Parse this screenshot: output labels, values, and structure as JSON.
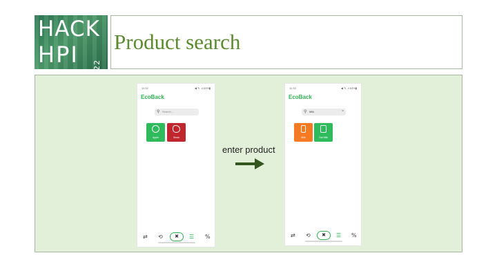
{
  "header": {
    "logo_line1": "HACK",
    "logo_line2": "HPI",
    "logo_year": "2022",
    "title": "Product search"
  },
  "arrow_label": "enter product",
  "phone_left": {
    "time": "11:32",
    "status_icons": "◀ ✎ .ıl 63%▮",
    "app_title": "EcoBack",
    "search_placeholder": "Search...",
    "tiles": [
      {
        "label": "Apple",
        "color": "#2fba5c",
        "icon": "apple-icon"
      },
      {
        "label": "Steak",
        "color": "#c0262d",
        "icon": "steak-icon"
      }
    ]
  },
  "phone_right": {
    "time": "11:33",
    "status_icons": "◀ ✎ .ıl 63%▮",
    "app_title": "EcoBack",
    "search_value": "Milk",
    "tiles": [
      {
        "label": "Milk",
        "color": "#f47a23",
        "icon": "milk-bottle-icon"
      },
      {
        "label": "Oat Milk",
        "color": "#2fba5c",
        "icon": "oat-milk-icon"
      }
    ]
  },
  "nav": {
    "swap": "⇄",
    "history": "⟲",
    "center": "✖",
    "list": "☰",
    "percent": "%"
  }
}
